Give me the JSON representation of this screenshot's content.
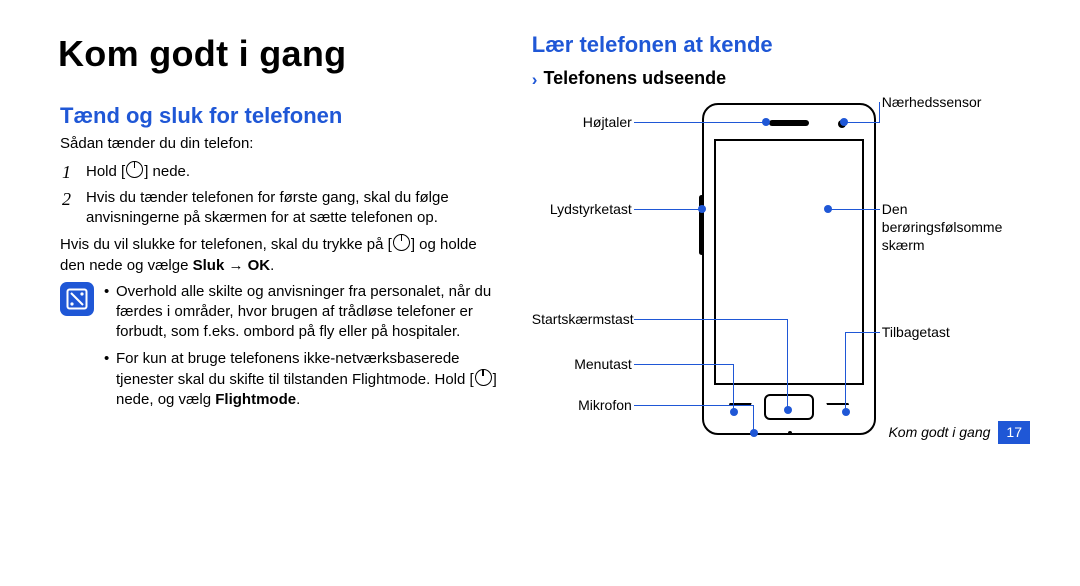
{
  "title": "Kom godt i gang",
  "left": {
    "heading": "Tænd og sluk for telefonen",
    "intro": "Sådan tænder du din telefon:",
    "step1_pre": "Hold [",
    "step1_post": "] nede.",
    "step2": "Hvis du tænder telefonen for første gang, skal du følge anvisningerne på skærmen for at sætte telefonen op.",
    "off_pre": "Hvis du vil slukke for telefonen, skal du trykke på [",
    "off_post": "] og holde den nede og vælge ",
    "off_bold": "Sluk → OK",
    "off_tail": ".",
    "note1": "Overhold alle skilte og anvisninger fra personalet, når du færdes i områder, hvor brugen af trådløse telefoner er forbudt, som f.eks. ombord på fly eller på hospitaler.",
    "note2_pre": "For kun at bruge telefonens ikke-netværksbaserede tjenester skal du skifte til tilstanden Flightmode. Hold [",
    "note2_post": "] nede, og vælg ",
    "note2_bold": "Flightmode",
    "note2_tail": "."
  },
  "right": {
    "heading": "Lær telefonen at kende",
    "subheading": "Telefonens udseende",
    "labels": {
      "earpiece": "Højtaler",
      "volume": "Lydstyrketast",
      "home": "Startskærmstast",
      "menu": "Menutast",
      "mic": "Mikrofon",
      "proximity": "Nærhedssensor",
      "screen_l1": "Den",
      "screen_l2": "berøringsfølsomme",
      "screen_l3": "skærm",
      "back": "Tilbagetast"
    }
  },
  "footer": {
    "running": "Kom godt i gang",
    "page": "17"
  }
}
